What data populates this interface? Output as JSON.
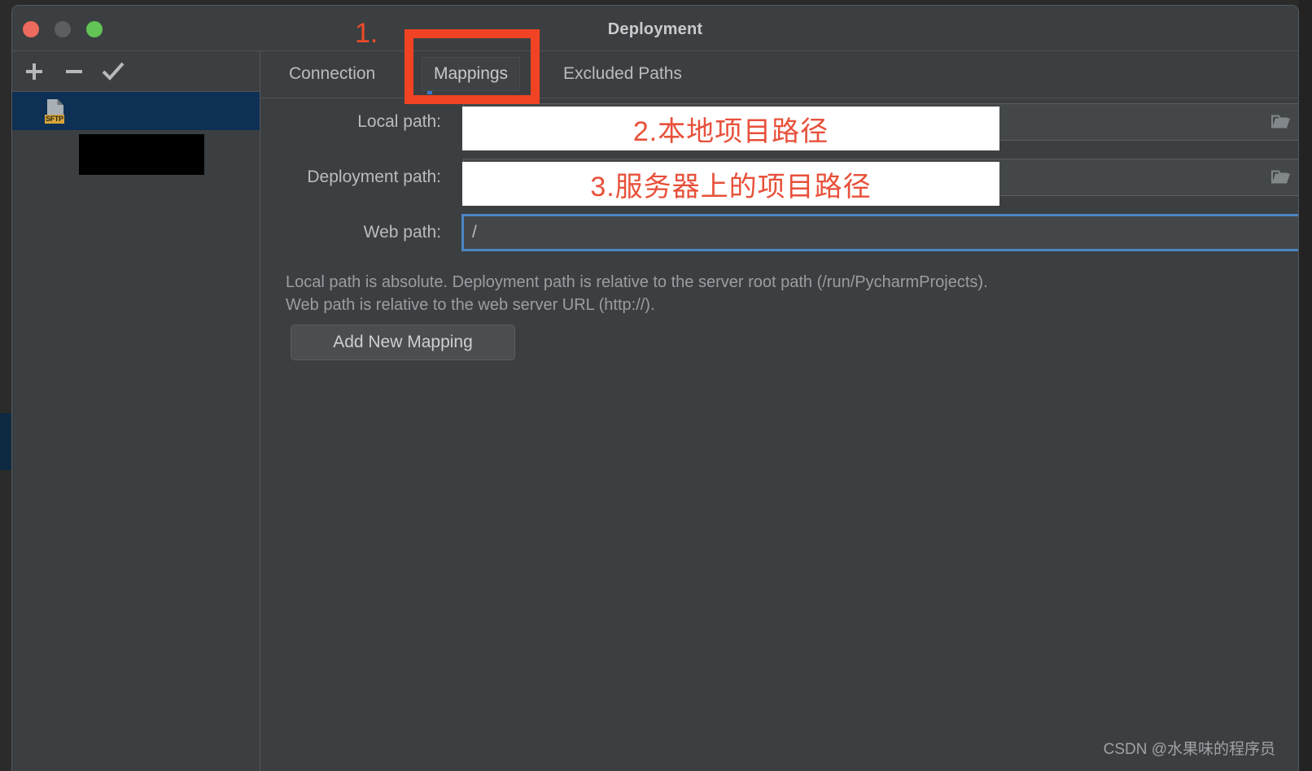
{
  "window": {
    "title": "Deployment",
    "controls": {
      "close": "close-button",
      "minimize": "minimize-button",
      "maximize": "maximize-button"
    }
  },
  "sidebar": {
    "toolbar": [
      {
        "name": "add",
        "label": "+"
      },
      {
        "name": "remove",
        "label": "−"
      },
      {
        "name": "apply",
        "label": "✓"
      }
    ],
    "items": [
      {
        "icon_label": "SFTP",
        "name": "",
        "selected": true
      }
    ]
  },
  "tabs": [
    {
      "id": "connection",
      "label": "Connection",
      "active": false
    },
    {
      "id": "mappings",
      "label": "Mappings",
      "active": true
    },
    {
      "id": "excluded-paths",
      "label": "Excluded Paths",
      "active": false
    }
  ],
  "form": {
    "local_path": {
      "label": "Local path:",
      "value": "",
      "browse": "folder-icon"
    },
    "deployment_path": {
      "label": "Deployment path:",
      "value": "",
      "browse": "folder-icon"
    },
    "web_path": {
      "label": "Web path:",
      "value": "/",
      "focused": true
    }
  },
  "help": {
    "line1": "Local path is absolute. Deployment path is relative to the server root path (/run/PycharmProjects).",
    "line2": "Web path is relative to the web server URL (http://)."
  },
  "buttons": {
    "add_new_mapping": "Add New Mapping"
  },
  "annotations": {
    "step1_number": "1.",
    "step2_text": "2.本地项目路径",
    "step3_text": "3.服务器上的项目路径",
    "color": "#f04323"
  },
  "watermark": "CSDN @水果味的程序员",
  "colors": {
    "window_bg": "#3c3f41",
    "selection": "#0d3054",
    "focus_border": "#4b86c4",
    "annotation_red": "#f04323",
    "traffic_close": "#ec6a5e",
    "traffic_min": "#5c5f61",
    "traffic_max": "#61c454",
    "sftp_badge": "#d8a43a"
  }
}
